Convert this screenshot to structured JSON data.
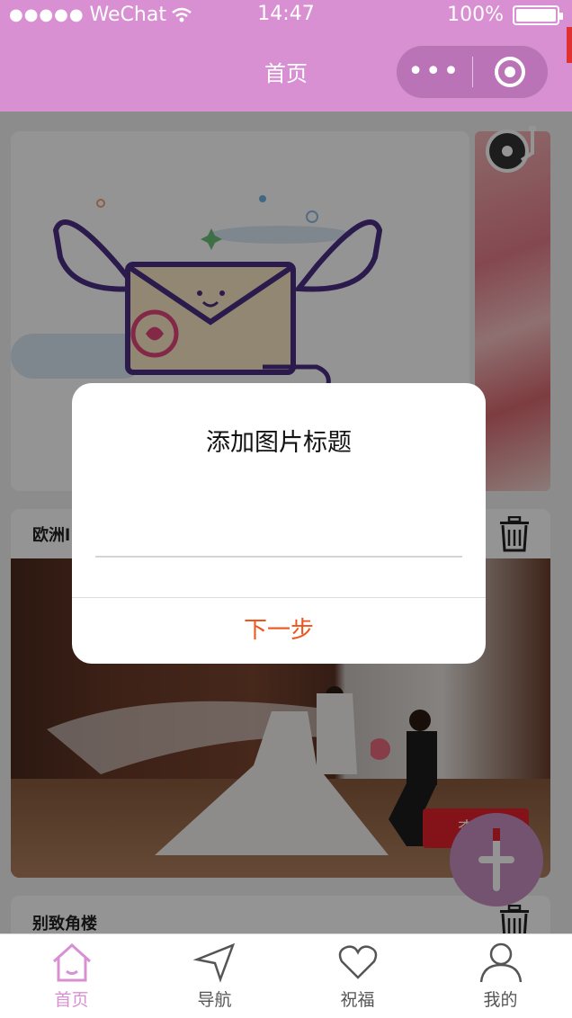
{
  "status_bar": {
    "signal": "●●●●●",
    "carrier": "WeChat",
    "time": "14:47",
    "battery_percent": "100%"
  },
  "nav_bar": {
    "title": "首页",
    "more_icon": "more-dots-icon",
    "close_icon": "target-circle-icon"
  },
  "cards": [
    {
      "title": "",
      "image": "flying-envelope-illustration"
    },
    {
      "title": "欧洲l",
      "image": "wedding-proposal-photo",
      "action_label": "查看"
    },
    {
      "title": "别致角楼"
    }
  ],
  "modal": {
    "title": "添加图片标题",
    "input_value": "",
    "input_placeholder": "",
    "next_label": "下一步"
  },
  "tabs": [
    {
      "label": "首页",
      "icon": "home-icon",
      "active": true
    },
    {
      "label": "导航",
      "icon": "navigation-arrow-icon",
      "active": false
    },
    {
      "label": "祝福",
      "icon": "heart-icon",
      "active": false
    },
    {
      "label": "我的",
      "icon": "user-icon",
      "active": false
    }
  ],
  "colors": {
    "theme": "#d890d2",
    "accent_button": "#f0541c",
    "view_button": "#e2222a"
  }
}
